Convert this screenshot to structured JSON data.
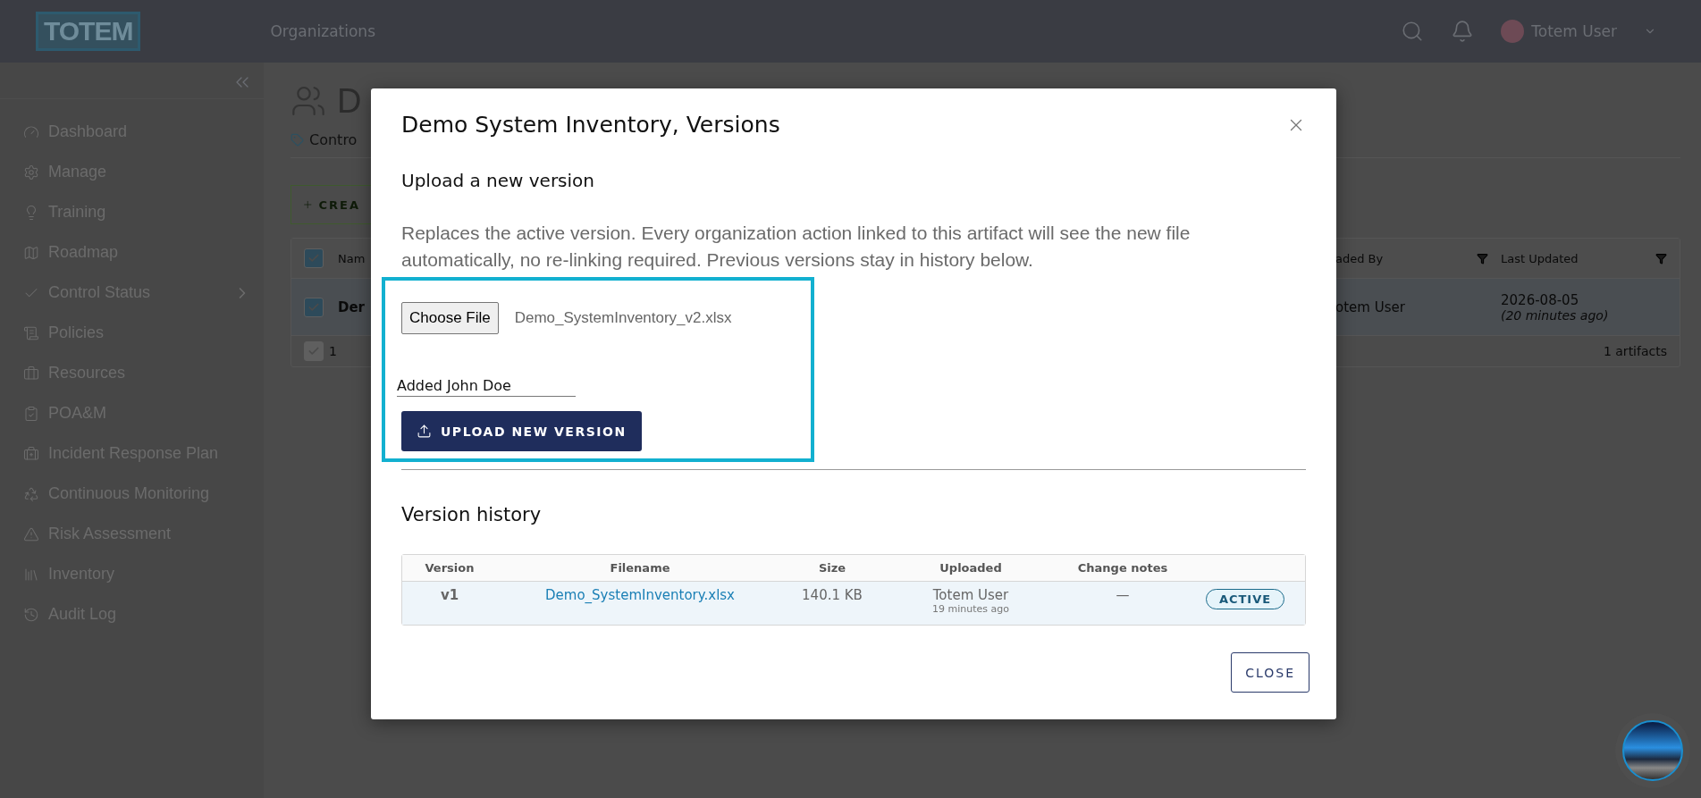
{
  "header": {
    "logo": "TOTEM",
    "nav": "Organizations",
    "user": "Totem User"
  },
  "sidebar": {
    "items": [
      {
        "label": "Dashboard",
        "submenu": false
      },
      {
        "label": "Manage",
        "submenu": false
      },
      {
        "label": "Training",
        "submenu": false
      },
      {
        "label": "Roadmap",
        "submenu": false
      },
      {
        "label": "Control Status",
        "submenu": true
      },
      {
        "label": "Policies",
        "submenu": false
      },
      {
        "label": "Resources",
        "submenu": false
      },
      {
        "label": "POA&M",
        "submenu": false
      },
      {
        "label": "Incident Response Plan",
        "submenu": false
      },
      {
        "label": "Continuous Monitoring",
        "submenu": false
      },
      {
        "label": "Risk Assessment",
        "submenu": false
      },
      {
        "label": "Inventory",
        "submenu": false
      },
      {
        "label": "Audit Log",
        "submenu": false
      }
    ]
  },
  "page": {
    "title": "D",
    "tab": "Contro",
    "create_button": "CREA",
    "table": {
      "columns": [
        "Nam",
        "aded By",
        "Last Updated"
      ],
      "header_checked": true,
      "rows": [
        {
          "name": "Der",
          "uploaded_by": "otem User",
          "date": "2026-08-05",
          "ago": "(20 minutes ago)",
          "checked": true
        }
      ],
      "footer": {
        "count": "1",
        "total": "1 artifacts",
        "checked": true
      }
    }
  },
  "modal": {
    "title": "Demo System Inventory, Versions",
    "upload_heading": "Upload a new version",
    "description": "Replaces the active version. Every organization action linked to this artifact will see the new file automatically, no re-linking required. Previous versions stay in history below.",
    "choose_file": "Choose File",
    "file_name": "Demo_SystemInventory_v2.xlsx",
    "notes_value": "Added John Doe",
    "upload_button": "UPLOAD NEW VERSION",
    "history_heading": "Version history",
    "columns": [
      "Version",
      "Filename",
      "Size",
      "Uploaded",
      "Change notes"
    ],
    "rows": [
      {
        "version": "v1",
        "filename": "Demo_SystemInventory.xlsx",
        "size": "140.1 KB",
        "uploaded_by": "Totem User",
        "uploaded_ago": "19 minutes ago",
        "notes": "—",
        "status": "ACTIVE",
        "active": true
      }
    ],
    "close_button": "CLOSE"
  }
}
